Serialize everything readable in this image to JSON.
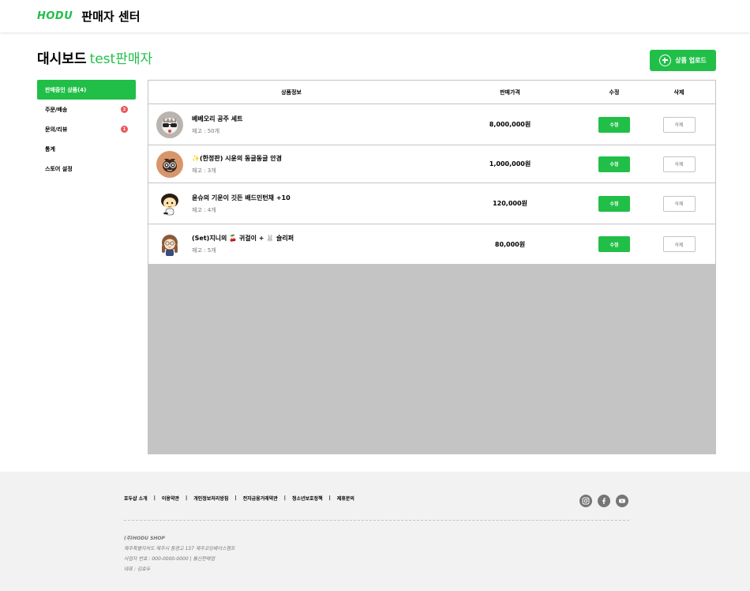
{
  "header": {
    "logo": "HODU",
    "title": "판매자 센터"
  },
  "dashboard": {
    "title": "대시보드",
    "seller_name": "test판매자",
    "upload_label": "상품 업로드"
  },
  "sidebar": {
    "items": [
      {
        "label": "판매중인 상품(4)",
        "active": true
      },
      {
        "label": "주문/배송",
        "badge": "2"
      },
      {
        "label": "문의/리뷰",
        "badge": "1"
      },
      {
        "label": "통계"
      },
      {
        "label": "스토어 설정"
      }
    ]
  },
  "table": {
    "headers": [
      "상품정보",
      "판매가격",
      "수정",
      "삭제"
    ],
    "edit_label": "수정",
    "delete_label": "삭제",
    "rows": [
      {
        "name": "베베오리 공주 세트",
        "stock": "재고 : 50개",
        "price": "8,000,000원"
      },
      {
        "name": "✨(한정판) 시윤의 동글동글 안경",
        "stock": "재고 : 3개",
        "price": "1,000,000원"
      },
      {
        "name": "윤슈의 기운이 깃든 배드민턴채 +10",
        "stock": "재고 : 4개",
        "price": "120,000원"
      },
      {
        "name": "(Set)지니의 🍒 귀걸이 + 🐰 슬리퍼",
        "stock": "재고 : 5개",
        "price": "80,000원"
      }
    ]
  },
  "footer": {
    "links": [
      "호두샵 소개",
      "이용약관",
      "개인정보처리방침",
      "전자금융거래약관",
      "청소년보호정책",
      "제휴문의"
    ],
    "socials": [
      "instagram-icon",
      "facebook-icon",
      "youtube-icon"
    ],
    "company": {
      "name": "(주)HODU SHOP",
      "address": "제주특별자치도 제주시 동광고 137 제주코딩베이스캠프",
      "business": "사업자 번호 : 000-0000-0000 | 통신판매업",
      "ceo": "대표 : 김호두"
    }
  },
  "colors": {
    "accent": "#21BF48",
    "badge": "#EB5757",
    "gray": "#C4C4C4"
  }
}
